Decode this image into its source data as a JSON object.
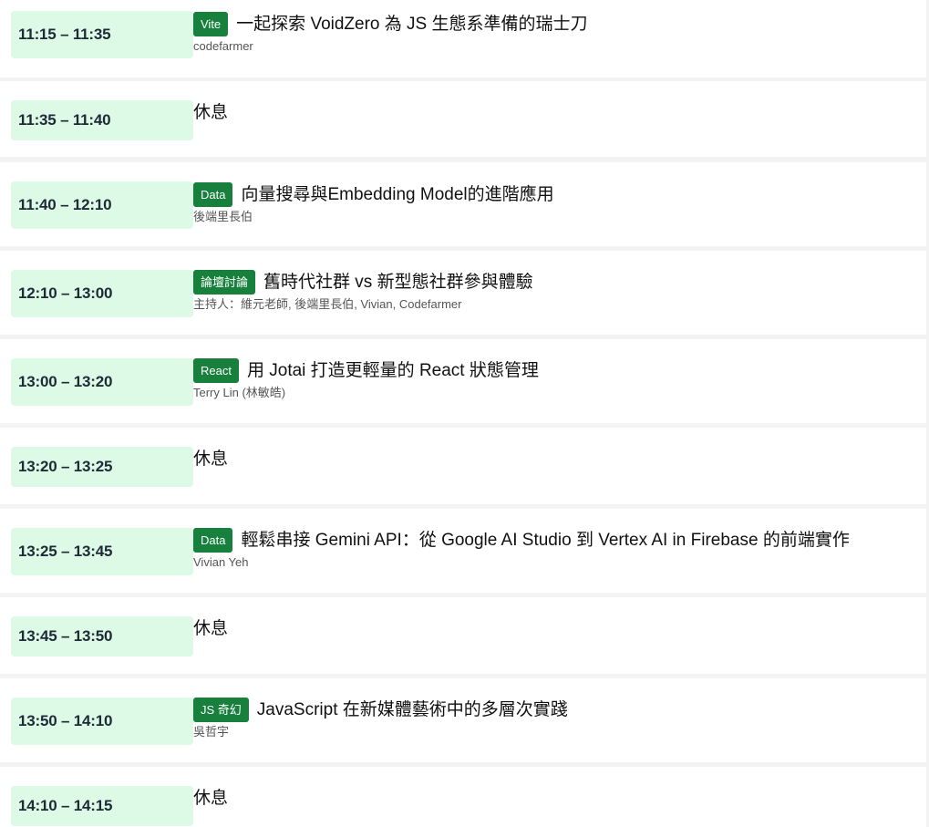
{
  "sessions": [
    {
      "time": "11:15 – 11:35",
      "tag": "Vite",
      "title": "一起探索 VoidZero 為 JS 生態系準備的瑞士刀",
      "speaker": "codefarmer"
    },
    {
      "time": "11:35 – 11:40",
      "title": "休息"
    },
    {
      "time": "11:40 – 12:10",
      "tag": "Data",
      "title": "向量搜尋與Embedding Model的進階應用",
      "speaker": "後端里長伯"
    },
    {
      "time": "12:10 – 13:00",
      "tag": "論壇討論",
      "title": "舊時代社群 vs 新型態社群參與體驗",
      "speaker": "主持人：維元老師, 後端里長伯, Vivian, Codefarmer"
    },
    {
      "time": "13:00 – 13:20",
      "tag": "React",
      "title": "用 Jotai 打造更輕量的 React 狀態管理",
      "speaker": "Terry Lin (林敏皓)"
    },
    {
      "time": "13:20 – 13:25",
      "title": "休息"
    },
    {
      "time": "13:25 – 13:45",
      "tag": "Data",
      "title": "輕鬆串接 Gemini API：從 Google AI Studio 到 Vertex AI in Firebase 的前端實作",
      "speaker": "Vivian Yeh"
    },
    {
      "time": "13:45 – 13:50",
      "title": "休息"
    },
    {
      "time": "13:50 – 14:10",
      "tag": "JS 奇幻",
      "title": "JavaScript 在新媒體藝術中的多層次實踐",
      "speaker": "吳哲宇"
    },
    {
      "time": "14:10 – 14:15",
      "title": "休息"
    }
  ],
  "colors": {
    "time_bg": "#dcfae6",
    "tag_bg": "#16803c",
    "tag_text": "#ffffff",
    "page_bg": "#f3f3f3"
  }
}
